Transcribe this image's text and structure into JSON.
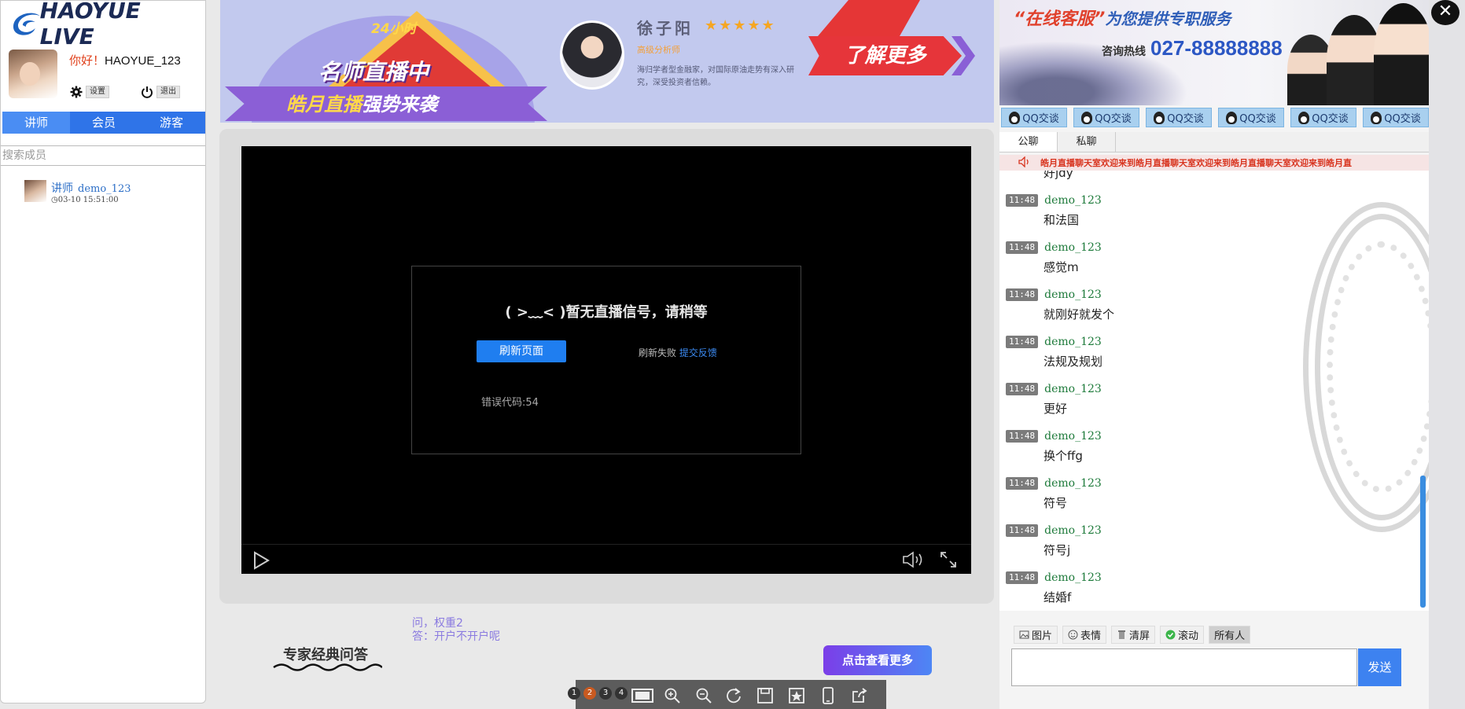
{
  "logo": {
    "text_a": "HAOYUE",
    "text_b": "LIVE"
  },
  "user": {
    "greeting": "你好！",
    "name": "HAOYUE_123",
    "settings_label": "设置",
    "logout_label": "退出"
  },
  "left_tabs": [
    "讲师",
    "会员",
    "游客"
  ],
  "search": {
    "placeholder": "搜索成员"
  },
  "members": [
    {
      "role": "讲师",
      "name": "demo_123",
      "time": "03-10 15:51:00"
    }
  ],
  "banner": {
    "hours": "24小时",
    "headline": "名师直播中",
    "slogan_a": "皓月直播",
    "slogan_b": "强势来袭",
    "teacher_name": "徐子阳",
    "stars": "★★★★★",
    "teacher_title": "高级分析师",
    "teacher_desc": "海归学者型金融家，对国际原油走势有深入研究，深受投资者信赖。",
    "learn_more": "了解更多"
  },
  "player": {
    "message": "( >﹏< )暂无直播信号，请稍等",
    "refresh_label": "刷新页面",
    "fail_text": "刷新失败",
    "feedback_link": "提交反馈",
    "error_code": "错误代码:54"
  },
  "qa": {
    "title": "专家经典问答",
    "question": "问，权重2",
    "answer": "答：开户不开户呢",
    "more_label": "点击查看更多"
  },
  "toolbar": {
    "page_dots": [
      "1",
      "2",
      "3",
      "4"
    ],
    "active_dot": 1
  },
  "service": {
    "headline_a": "“在线客服”",
    "headline_b": "为您提供专职服务",
    "hotline_label": "咨询热线",
    "phone": "027-88888888"
  },
  "qq_buttons": [
    "QQ交谈",
    "QQ交谈",
    "QQ交谈",
    "QQ交谈",
    "QQ交谈",
    "QQ交谈"
  ],
  "chat_tabs": [
    "公聊",
    "私聊"
  ],
  "marquee": "皓月直播聊天室欢迎来到皓月直播聊天室欢迎来到皓月直播聊天室欢迎来到皓月直",
  "chat": {
    "partial_top": "好jdy",
    "messages": [
      {
        "time": "11:48",
        "name": "demo_123",
        "text": "和法国"
      },
      {
        "time": "11:48",
        "name": "demo_123",
        "text": "感觉m"
      },
      {
        "time": "11:48",
        "name": "demo_123",
        "text": "就刚好就发个"
      },
      {
        "time": "11:48",
        "name": "demo_123",
        "text": "法规及规划"
      },
      {
        "time": "11:48",
        "name": "demo_123",
        "text": "更好"
      },
      {
        "time": "11:48",
        "name": "demo_123",
        "text": "换个ffg"
      },
      {
        "time": "11:48",
        "name": "demo_123",
        "text": "符号"
      },
      {
        "time": "11:48",
        "name": "demo_123",
        "text": "符号j"
      },
      {
        "time": "11:48",
        "name": "demo_123",
        "text": "结婚f"
      }
    ]
  },
  "chat_tools": {
    "image": "图片",
    "emoji": "表情",
    "clear": "清屏",
    "scroll": "滚动",
    "recipient": "所有人"
  },
  "send_label": "发送",
  "close_glyph": "✕"
}
